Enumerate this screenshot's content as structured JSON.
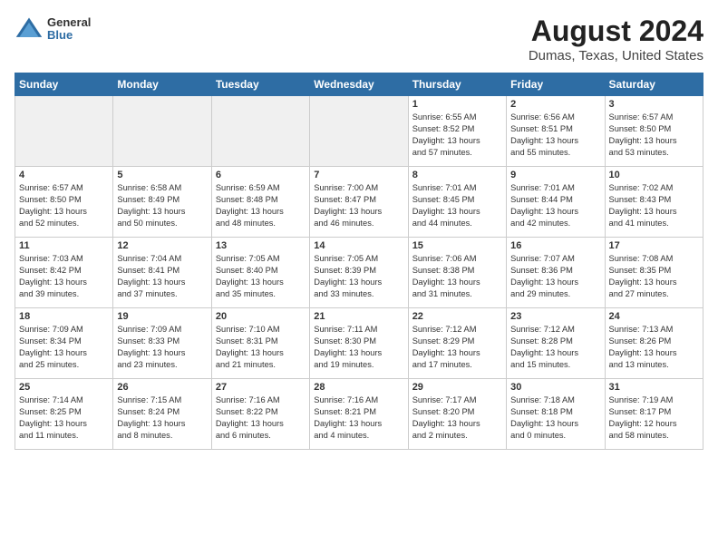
{
  "header": {
    "logo_line1": "General",
    "logo_line2": "Blue",
    "title": "August 2024",
    "subtitle": "Dumas, Texas, United States"
  },
  "weekdays": [
    "Sunday",
    "Monday",
    "Tuesday",
    "Wednesday",
    "Thursday",
    "Friday",
    "Saturday"
  ],
  "weeks": [
    [
      {
        "day": "",
        "info": ""
      },
      {
        "day": "",
        "info": ""
      },
      {
        "day": "",
        "info": ""
      },
      {
        "day": "",
        "info": ""
      },
      {
        "day": "1",
        "info": "Sunrise: 6:55 AM\nSunset: 8:52 PM\nDaylight: 13 hours\nand 57 minutes."
      },
      {
        "day": "2",
        "info": "Sunrise: 6:56 AM\nSunset: 8:51 PM\nDaylight: 13 hours\nand 55 minutes."
      },
      {
        "day": "3",
        "info": "Sunrise: 6:57 AM\nSunset: 8:50 PM\nDaylight: 13 hours\nand 53 minutes."
      }
    ],
    [
      {
        "day": "4",
        "info": "Sunrise: 6:57 AM\nSunset: 8:50 PM\nDaylight: 13 hours\nand 52 minutes."
      },
      {
        "day": "5",
        "info": "Sunrise: 6:58 AM\nSunset: 8:49 PM\nDaylight: 13 hours\nand 50 minutes."
      },
      {
        "day": "6",
        "info": "Sunrise: 6:59 AM\nSunset: 8:48 PM\nDaylight: 13 hours\nand 48 minutes."
      },
      {
        "day": "7",
        "info": "Sunrise: 7:00 AM\nSunset: 8:47 PM\nDaylight: 13 hours\nand 46 minutes."
      },
      {
        "day": "8",
        "info": "Sunrise: 7:01 AM\nSunset: 8:45 PM\nDaylight: 13 hours\nand 44 minutes."
      },
      {
        "day": "9",
        "info": "Sunrise: 7:01 AM\nSunset: 8:44 PM\nDaylight: 13 hours\nand 42 minutes."
      },
      {
        "day": "10",
        "info": "Sunrise: 7:02 AM\nSunset: 8:43 PM\nDaylight: 13 hours\nand 41 minutes."
      }
    ],
    [
      {
        "day": "11",
        "info": "Sunrise: 7:03 AM\nSunset: 8:42 PM\nDaylight: 13 hours\nand 39 minutes."
      },
      {
        "day": "12",
        "info": "Sunrise: 7:04 AM\nSunset: 8:41 PM\nDaylight: 13 hours\nand 37 minutes."
      },
      {
        "day": "13",
        "info": "Sunrise: 7:05 AM\nSunset: 8:40 PM\nDaylight: 13 hours\nand 35 minutes."
      },
      {
        "day": "14",
        "info": "Sunrise: 7:05 AM\nSunset: 8:39 PM\nDaylight: 13 hours\nand 33 minutes."
      },
      {
        "day": "15",
        "info": "Sunrise: 7:06 AM\nSunset: 8:38 PM\nDaylight: 13 hours\nand 31 minutes."
      },
      {
        "day": "16",
        "info": "Sunrise: 7:07 AM\nSunset: 8:36 PM\nDaylight: 13 hours\nand 29 minutes."
      },
      {
        "day": "17",
        "info": "Sunrise: 7:08 AM\nSunset: 8:35 PM\nDaylight: 13 hours\nand 27 minutes."
      }
    ],
    [
      {
        "day": "18",
        "info": "Sunrise: 7:09 AM\nSunset: 8:34 PM\nDaylight: 13 hours\nand 25 minutes."
      },
      {
        "day": "19",
        "info": "Sunrise: 7:09 AM\nSunset: 8:33 PM\nDaylight: 13 hours\nand 23 minutes."
      },
      {
        "day": "20",
        "info": "Sunrise: 7:10 AM\nSunset: 8:31 PM\nDaylight: 13 hours\nand 21 minutes."
      },
      {
        "day": "21",
        "info": "Sunrise: 7:11 AM\nSunset: 8:30 PM\nDaylight: 13 hours\nand 19 minutes."
      },
      {
        "day": "22",
        "info": "Sunrise: 7:12 AM\nSunset: 8:29 PM\nDaylight: 13 hours\nand 17 minutes."
      },
      {
        "day": "23",
        "info": "Sunrise: 7:12 AM\nSunset: 8:28 PM\nDaylight: 13 hours\nand 15 minutes."
      },
      {
        "day": "24",
        "info": "Sunrise: 7:13 AM\nSunset: 8:26 PM\nDaylight: 13 hours\nand 13 minutes."
      }
    ],
    [
      {
        "day": "25",
        "info": "Sunrise: 7:14 AM\nSunset: 8:25 PM\nDaylight: 13 hours\nand 11 minutes."
      },
      {
        "day": "26",
        "info": "Sunrise: 7:15 AM\nSunset: 8:24 PM\nDaylight: 13 hours\nand 8 minutes."
      },
      {
        "day": "27",
        "info": "Sunrise: 7:16 AM\nSunset: 8:22 PM\nDaylight: 13 hours\nand 6 minutes."
      },
      {
        "day": "28",
        "info": "Sunrise: 7:16 AM\nSunset: 8:21 PM\nDaylight: 13 hours\nand 4 minutes."
      },
      {
        "day": "29",
        "info": "Sunrise: 7:17 AM\nSunset: 8:20 PM\nDaylight: 13 hours\nand 2 minutes."
      },
      {
        "day": "30",
        "info": "Sunrise: 7:18 AM\nSunset: 8:18 PM\nDaylight: 13 hours\nand 0 minutes."
      },
      {
        "day": "31",
        "info": "Sunrise: 7:19 AM\nSunset: 8:17 PM\nDaylight: 12 hours\nand 58 minutes."
      }
    ]
  ]
}
